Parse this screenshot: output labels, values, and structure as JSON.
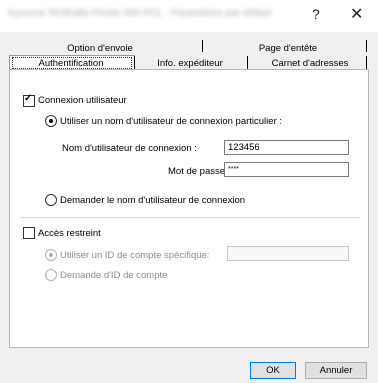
{
  "window": {
    "title": "Kyocera TASKalfa Printer 000 PCL - Paramètres par défaut",
    "help_glyph": "?",
    "close_glyph": "✕"
  },
  "tabs": {
    "row_back": [
      {
        "label": "Option d'envoie"
      },
      {
        "label": "Page d'entête"
      }
    ],
    "row_front": [
      {
        "label": "Authentification",
        "active": true
      },
      {
        "label": "Info. expéditeur"
      },
      {
        "label": "Carnet d'adresses"
      }
    ]
  },
  "auth": {
    "user_login_label": "Connexion utilisateur",
    "user_login_checked": true,
    "use_specific_label": "Utiliser un nom d'utilisateur de connexion particulier :",
    "login_name_label": "Nom d'utilisateur de connexion :",
    "login_name_value": "123456",
    "password_label": "Mot de passe:",
    "password_value": "****",
    "ask_name_label": "Demander le nom d'utilisateur de connexion"
  },
  "restricted": {
    "label": "Accès restreint",
    "checked": false,
    "use_account_label": "Utiliser un ID de compte spécifique:",
    "account_value": "",
    "ask_account_label": "Demande d'ID de compte"
  },
  "buttons": {
    "ok": "OK",
    "cancel": "Annuler"
  }
}
